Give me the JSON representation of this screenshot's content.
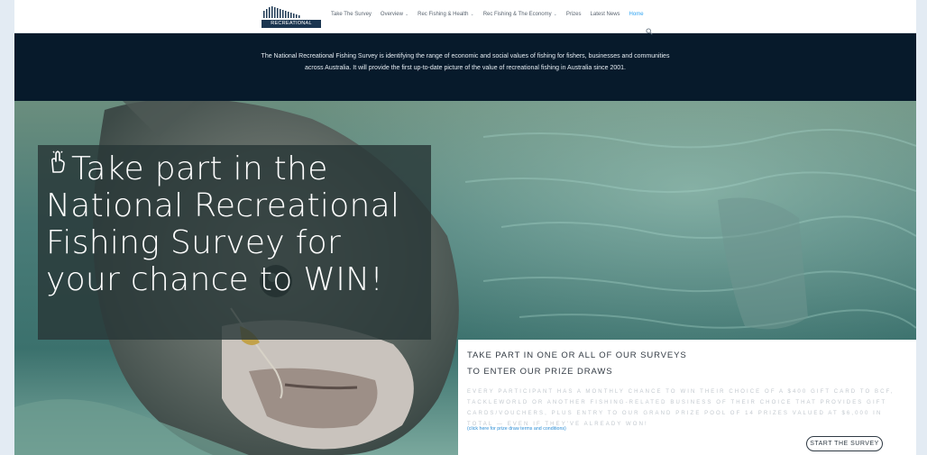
{
  "header": {
    "logo_text": "RECREATIONAL FISHING",
    "nav": [
      {
        "label": "Take The Survey",
        "dropdown": false
      },
      {
        "label": "Overview",
        "dropdown": true
      },
      {
        "label": "Rec Fishing & Health",
        "dropdown": true
      },
      {
        "label": "Rec Fishing & The Economy",
        "dropdown": true
      },
      {
        "label": "Prizes",
        "dropdown": false
      },
      {
        "label": "Latest News",
        "dropdown": false
      },
      {
        "label": "Home",
        "dropdown": false,
        "active": true
      }
    ],
    "chevron": "⌄"
  },
  "intro": {
    "text": "The National Recreational Fishing Survey is identifying the range of economic and social values of fishing for fishers, businesses and communities across Australia. It will provide the first up-to-date picture of the value of recreational fishing in Australia since 2001."
  },
  "hero": {
    "headline": "Take part in the National Recreational Fishing Survey for your chance to WIN!"
  },
  "panel": {
    "title_line1": "TAKE PART IN ONE OR ALL OF OUR SURVEYS",
    "title_line2": "TO ENTER OUR PRIZE DRAWS",
    "body": "Every participant has a monthly chance to win their choice of a $400 gift card to BCF, Tackleworld or another fishing-related business of their choice that provides gift cards/vouchers, plus entry to our grand prize pool of 14 prizes valued at $6,000 in total — even if they've already won!",
    "link": "(click here for prize draw terms and conditions)",
    "button": "START THE SURVEY"
  },
  "colors": {
    "nav_active": "#2ea3f2",
    "intro_bg": "#071a2b",
    "link": "#2e8fd6"
  },
  "icons": [
    "search-icon",
    "pointing-hand-icon",
    "chevron-down-icon"
  ]
}
